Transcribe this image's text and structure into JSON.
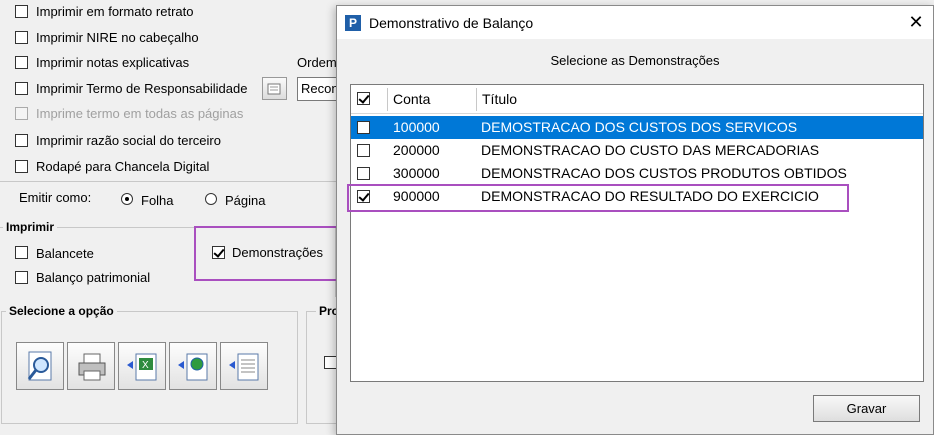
{
  "options": [
    {
      "label": "Imprimir em formato retrato",
      "checked": false,
      "disabled": false
    },
    {
      "label": "Imprimir NIRE no cabeçalho",
      "checked": false,
      "disabled": false
    },
    {
      "label": "Imprimir notas explicativas",
      "checked": false,
      "disabled": false
    },
    {
      "label": "Imprimir Termo de Responsabilidade",
      "checked": false,
      "disabled": false
    },
    {
      "label": "Imprime termo em todas as páginas",
      "checked": false,
      "disabled": true
    },
    {
      "label": "Imprimir razão social do terceiro",
      "checked": false,
      "disabled": false
    },
    {
      "label": "Rodapé para Chancela Digital",
      "checked": false,
      "disabled": false
    }
  ],
  "ordem": {
    "label": "Ordem",
    "value": "Recon"
  },
  "emitir": {
    "label": "Emitir como:",
    "option1": "Folha",
    "option2": "Página",
    "selected": "Folha"
  },
  "imprimir": {
    "title": "Imprimir",
    "balancete": "Balancete",
    "balanco": "Balanço patrimonial",
    "demonstracoes": "Demonstrações",
    "demonstracoes_checked": true
  },
  "selecione": {
    "title": "Selecione a opção",
    "buttons": [
      "preview-icon",
      "printer-icon",
      "excel-export-icon",
      "web-export-icon",
      "document-export-icon"
    ]
  },
  "pro_title": "Pro",
  "dialog": {
    "app_icon": "P",
    "title": "Demonstrativo de Balanço",
    "close": "✕",
    "subtitle": "Selecione as Demonstrações",
    "columns": {
      "conta": "Conta",
      "titulo": "Título"
    },
    "header_checked": true,
    "rows": [
      {
        "conta": "100000",
        "titulo": "DEMOSTRACAO DOS CUSTOS DOS SERVICOS",
        "checked": false,
        "selected": true
      },
      {
        "conta": "200000",
        "titulo": "DEMONSTRACAO DO CUSTO DAS MERCADORIAS",
        "checked": false,
        "selected": false
      },
      {
        "conta": "300000",
        "titulo": "DEMONSTRACAO DOS CUSTOS PRODUTOS OBTIDOS",
        "checked": false,
        "selected": false
      },
      {
        "conta": "900000",
        "titulo": "DEMONSTRACAO DO RESULTADO DO EXERCICIO",
        "checked": true,
        "selected": false
      }
    ],
    "save_button": "Gravar"
  },
  "colors": {
    "highlight": "#a94fbf",
    "selection": "#0078d7"
  }
}
